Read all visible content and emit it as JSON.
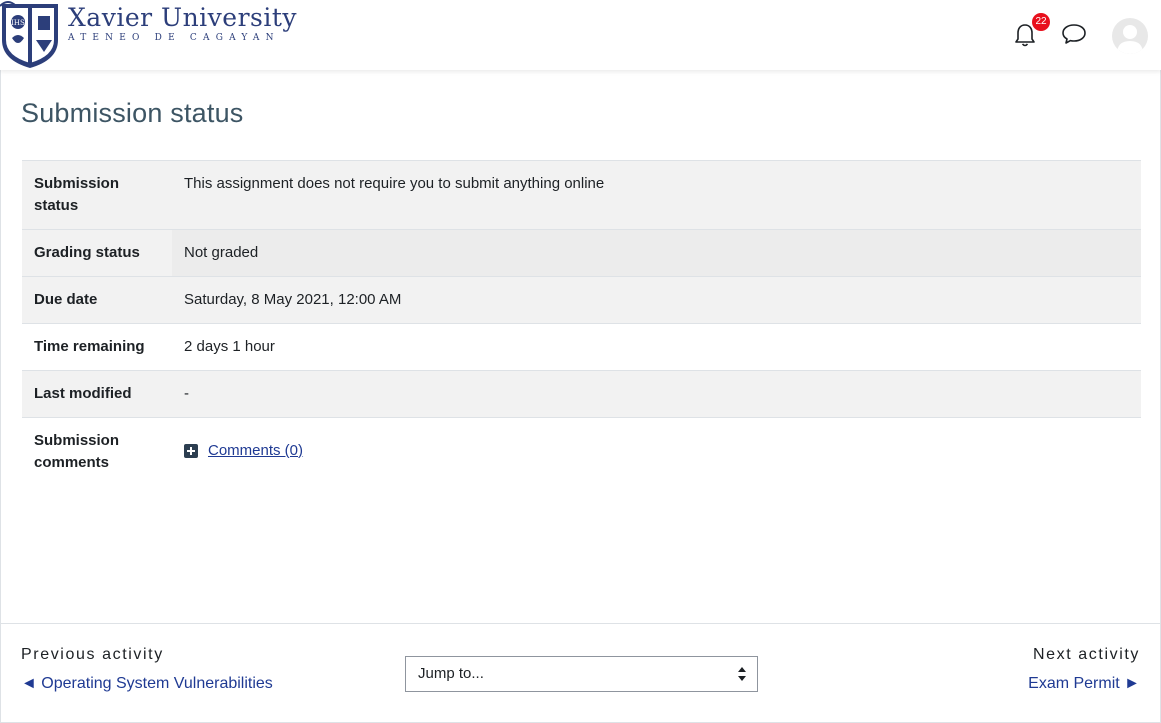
{
  "header": {
    "brand_name": "Xavier University",
    "brand_subtitle": "ATENEO DE CAGAYAN",
    "notification_count": "22",
    "badge_color": "#e8101d",
    "icons": [
      "bell-icon",
      "chat-icon",
      "avatar"
    ]
  },
  "main": {
    "title": "Submission status",
    "rows": [
      {
        "label": "Submission status",
        "value": "This assignment does not require you to submit anything online"
      },
      {
        "label": "Grading status",
        "value": "Not graded"
      },
      {
        "label": "Due date",
        "value": "Saturday, 8 May 2021, 12:00 AM"
      },
      {
        "label": "Time remaining",
        "value": "2 days 1 hour"
      },
      {
        "label": "Last modified",
        "value": "-"
      },
      {
        "label": "Submission comments",
        "value": "Comments (0)"
      }
    ]
  },
  "activity_nav": {
    "previous_label": "Previous activity",
    "previous_link": "◄ Operating System Vulnerabilities",
    "jump_placeholder": "Jump to...",
    "next_label": "Next activity",
    "next_link": "Exam Permit ►"
  },
  "colors": {
    "brand": "#2c3e7a",
    "link": "#1f3a93",
    "title": "#3d5564"
  }
}
